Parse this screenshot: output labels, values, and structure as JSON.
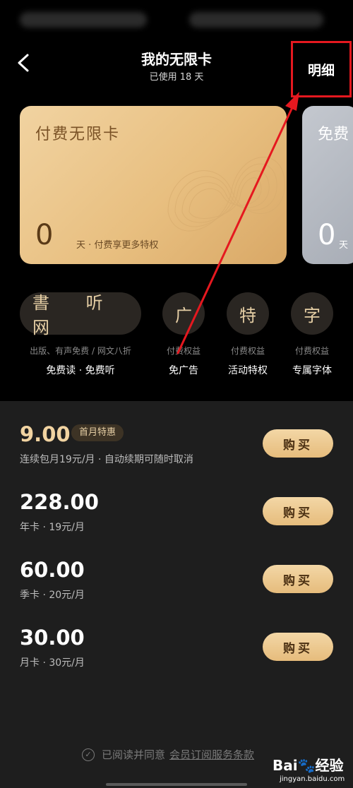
{
  "header": {
    "title": "我的无限卡",
    "subtitle": "已使用 18 天",
    "detail_label": "明细"
  },
  "cards": {
    "paid": {
      "title": "付费无限卡",
      "days": "0",
      "unit_desc": "天 · 付费享更多特权"
    },
    "free": {
      "title": "免费",
      "days": "0",
      "unit": "天"
    }
  },
  "benefits": [
    {
      "icon_text": "書 听 网",
      "sub": "出版、有声免费 / 网文八折",
      "name": "免费读 · 免费听"
    },
    {
      "icon_text": "广",
      "sub": "付费权益",
      "name": "免广告"
    },
    {
      "icon_text": "特",
      "sub": "付费权益",
      "name": "活动特权"
    },
    {
      "icon_text": "字",
      "sub": "付费权益",
      "name": "专属字体"
    }
  ],
  "plans": [
    {
      "price": "9.00",
      "tag": "首月特惠",
      "desc": "连续包月19元/月 · 自动续期可随时取消",
      "button": "购买"
    },
    {
      "price": "228.00",
      "desc": "年卡 · 19元/月",
      "button": "购买"
    },
    {
      "price": "60.00",
      "desc": "季卡 · 20元/月",
      "button": "购买"
    },
    {
      "price": "30.00",
      "desc": "月卡 · 30元/月",
      "button": "购买"
    }
  ],
  "agreement": {
    "text": "已阅读并同意",
    "link": "会员订阅服务条款"
  },
  "watermark": {
    "logo": "Bai🐾经验",
    "url": "jingyan.baidu.com"
  },
  "colors": {
    "gold": "#e6bc7c",
    "annotation_red": "#e5181f"
  }
}
